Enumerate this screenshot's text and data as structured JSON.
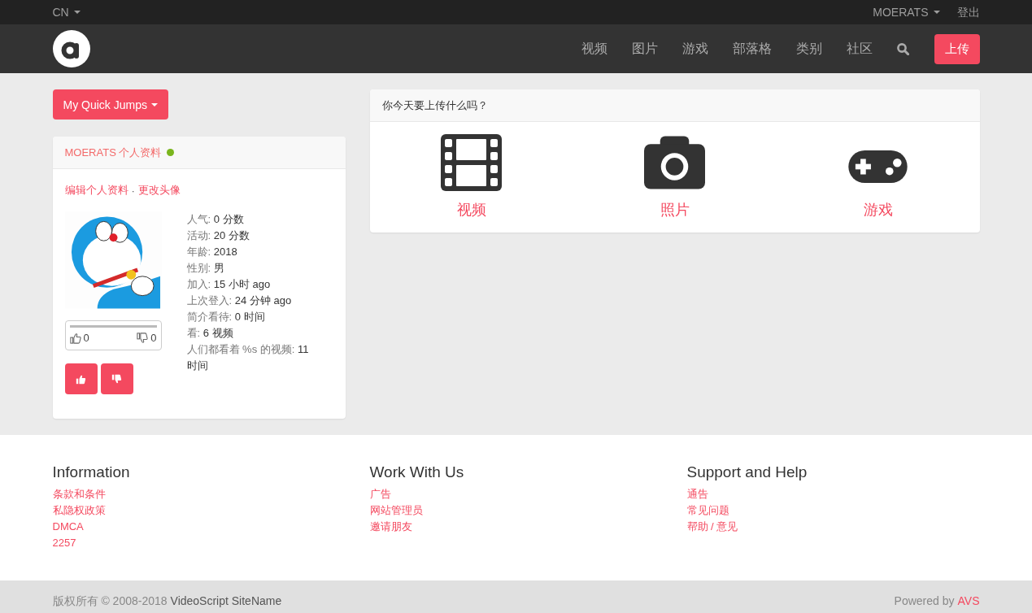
{
  "top_bar": {
    "language": "CN",
    "user": "MOERATS",
    "logout": "登出"
  },
  "navbar": {
    "items": [
      {
        "label": "视频",
        "selected": false
      },
      {
        "label": "图片",
        "selected": false
      },
      {
        "label": "游戏",
        "selected": false
      },
      {
        "label": "部落格",
        "selected": false
      },
      {
        "label": "类别",
        "selected": false
      },
      {
        "label": "社区",
        "selected": false
      }
    ],
    "upload_button": "上传"
  },
  "quick_jumps": {
    "label": "My Quick Jumps"
  },
  "profile_card": {
    "title": "MOERATS 个人资料",
    "online": true,
    "links": [
      "编辑个人资料",
      "更改头像"
    ],
    "link_separator": "·",
    "stats": [
      {
        "label": "人气:",
        "value": "0 分数"
      },
      {
        "label": "活动:",
        "value": "20 分数"
      },
      {
        "label": "年龄:",
        "value": "2018"
      },
      {
        "label": "性别:",
        "value": "男"
      },
      {
        "label": "加入:",
        "value": "15 小时 ago"
      },
      {
        "label": "上次登入:",
        "value": "24 分钟 ago"
      },
      {
        "label": "简介看待:",
        "value": "0 时间"
      },
      {
        "label": "看:",
        "value": "6 视频"
      },
      {
        "label": "人们都看着 %s 的视频:",
        "value": "11 时间"
      }
    ],
    "rating": {
      "likes": "0",
      "dislikes": "0"
    }
  },
  "upload_card": {
    "title": "你今天要上传什么吗？",
    "options": [
      {
        "kind": "video",
        "label": "视频"
      },
      {
        "kind": "photo",
        "label": "照片"
      },
      {
        "kind": "game",
        "label": "游戏"
      }
    ]
  },
  "footer": {
    "columns": [
      {
        "heading": "Information",
        "links": [
          "条款和条件",
          "私隐权政策",
          "DMCA",
          "2257"
        ]
      },
      {
        "heading": "Work With Us",
        "links": [
          "广告",
          "网站管理员",
          "邀请朋友"
        ]
      },
      {
        "heading": "Support and Help",
        "links": [
          "通告",
          "常见问题",
          "帮助 / 意见"
        ]
      }
    ],
    "copyright": {
      "text": "版权所有 © 2008-2018",
      "site": "VideoScript SiteName"
    },
    "powered": {
      "text": "Powered by",
      "link": "AVS"
    }
  }
}
